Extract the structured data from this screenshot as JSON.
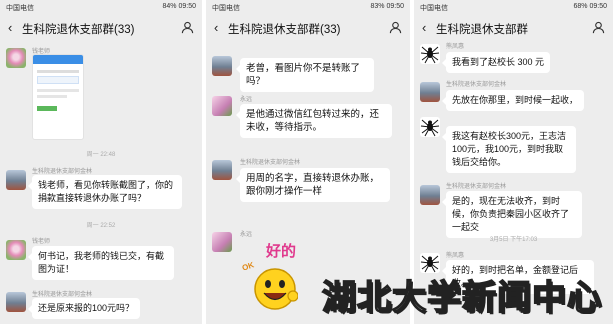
{
  "panels": [
    {
      "status": {
        "carrier": "中国电信",
        "right": "84% 09:50"
      },
      "title": "生科院退休支部群(33)",
      "messages": [
        {
          "sender": "钱老师"
        },
        {
          "timestamp": "周一 22:48"
        },
        {
          "sender": "生科院退休支部何金林",
          "text": "钱老师，看见你转账截图了，你的捐款直接转退休办账了吗？"
        },
        {
          "timestamp": "周一 22:52"
        },
        {
          "sender": "钱老师",
          "text": "何书记，我老师的钱已交，有截图为证！"
        },
        {
          "sender": "生科院退休支部何金林",
          "text": "还是原来报的100元吗？"
        }
      ]
    },
    {
      "status": {
        "carrier": "中国电信",
        "right": "83% 09:50"
      },
      "title": "生科院退休支部群(33)",
      "messages": [
        {
          "text": "老曾，看图片你不是转账了吗？"
        },
        {
          "sender": "永远",
          "text": "是他通过微信红包转过来的，还未收，等待指示。"
        },
        {
          "sender": "生科院退休支部何金林",
          "text": "用周的名字，直接转退休办账，跟你刚才操作一样"
        },
        {
          "sender": "永远",
          "sticker_text": "好的",
          "sticker_ok": "OK"
        }
      ]
    },
    {
      "status": {
        "carrier": "中国电信",
        "right": "68% 09:50"
      },
      "title": "生科院退休支部群",
      "messages": [
        {
          "sender": "熊凤惠",
          "text": "我看到了赵校长 300 元"
        },
        {
          "sender": "生科院退休支部何金林",
          "text": "先放在你那里，到时候一起收，"
        },
        {
          "text": "我这有赵校长300元，王志洁100元，我100元，到时我取钱后交给你。"
        },
        {
          "sender": "生科院退休支部何金林",
          "text": "是的，现在无法收齐，到时候，你负责把秦园小区收齐了一起交"
        },
        {
          "timestamp": "3月5日 下午17:03"
        },
        {
          "sender": "熊凤惠",
          "text": "好的，到时把名单，金额登记后收。"
        }
      ]
    }
  ],
  "watermark": "湖北大学新闻中心",
  "icons": {
    "back": "back-arrow-icon",
    "person": "person-icon",
    "spider": "spider-avatar"
  }
}
